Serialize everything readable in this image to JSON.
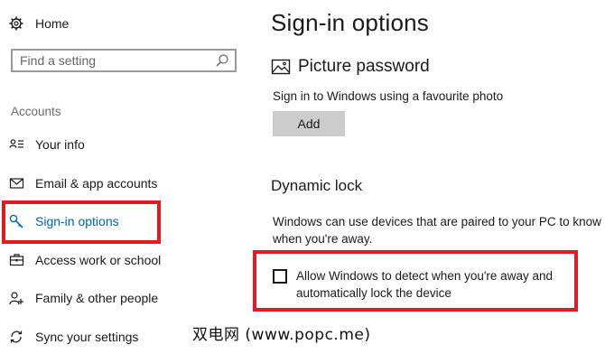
{
  "sidebar": {
    "home": {
      "label": "Home",
      "icon": "gear-icon"
    },
    "search": {
      "placeholder": "Find a setting",
      "value": "",
      "icon": "search-icon"
    },
    "section_label": "Accounts",
    "items": [
      {
        "label": "Your info",
        "icon": "person-card-icon",
        "active": false
      },
      {
        "label": "Email & app accounts",
        "icon": "mail-icon",
        "active": false
      },
      {
        "label": "Sign-in options",
        "icon": "key-icon",
        "active": true
      },
      {
        "label": "Access work or school",
        "icon": "briefcase-icon",
        "active": false
      },
      {
        "label": "Family & other people",
        "icon": "people-icon",
        "active": false
      },
      {
        "label": "Sync your settings",
        "icon": "sync-icon",
        "active": false
      }
    ]
  },
  "main": {
    "title": "Sign-in options",
    "picture_password": {
      "heading": "Picture password",
      "icon": "picture-icon",
      "description": "Sign in to Windows using a favourite photo",
      "add_label": "Add"
    },
    "dynamic_lock": {
      "heading": "Dynamic lock",
      "description_line1": "Windows can use devices that are paired to your PC to know",
      "description_line2": "when you're away.",
      "checkbox_line1": "Allow Windows to detect when you're away and",
      "checkbox_line2": "automatically lock the device",
      "checked": false
    }
  },
  "watermark": "双电网 (www.popc.me)",
  "colors": {
    "accent": "#0063b1",
    "highlight": "#e01b24",
    "button_bg": "#cccccc"
  }
}
